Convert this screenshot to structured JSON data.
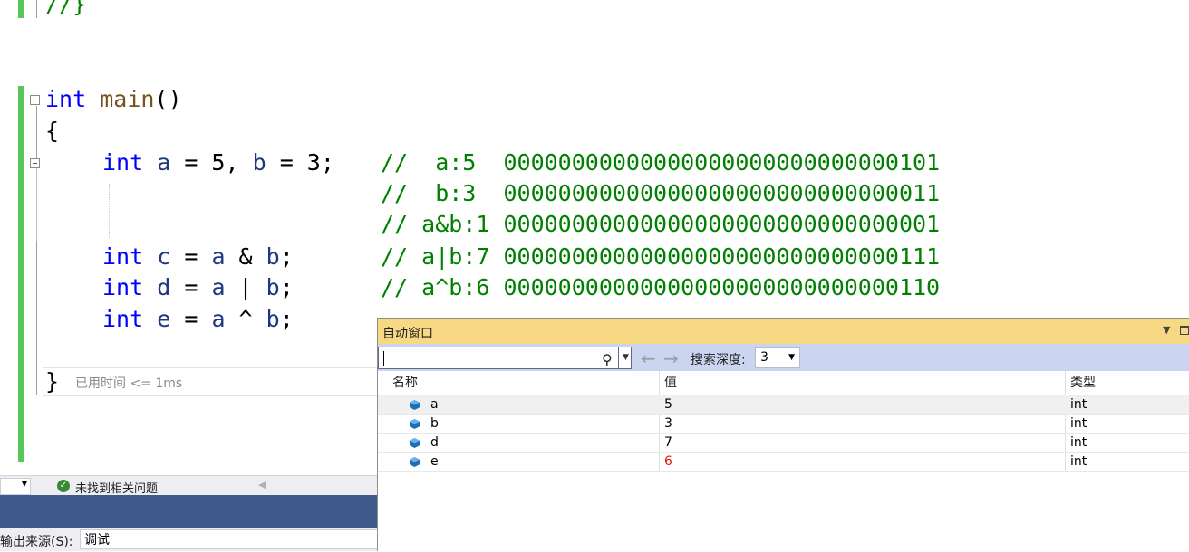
{
  "editor": {
    "line_prev": "//}",
    "line_main": {
      "kw": "int",
      "fn": "main",
      "rest": "()"
    },
    "line_open_brace": "{",
    "line_decl": {
      "kw": "int",
      "a": "a",
      "eq1": " = 5, ",
      "b": "b",
      "eq2": " = 3;"
    },
    "comments": [
      "//  a:5  00000000000000000000000000000101",
      "//  b:3  00000000000000000000000000000011",
      "// a&b:1 00000000000000000000000000000001",
      "// a|b:7 00000000000000000000000000000111",
      "// a^b:6 00000000000000000000000000000110"
    ],
    "line_c": {
      "kw": "int",
      "v": "c",
      "op1": " = ",
      "a": "a",
      "op": " & ",
      "b": "b",
      "end": ";"
    },
    "line_d": {
      "kw": "int",
      "v": "d",
      "op1": " = ",
      "a": "a",
      "op": " | ",
      "b": "b",
      "end": ";"
    },
    "line_e": {
      "kw": "int",
      "v": "e",
      "op1": " = ",
      "a": "a",
      "op": " ^ ",
      "b": "b",
      "end": ";"
    },
    "line_close_brace": "}",
    "elapsed": "已用时间 <= 1ms"
  },
  "status": {
    "issues": "未找到相关问题"
  },
  "output": {
    "source_label": "输出来源(S):",
    "source_value": "调试"
  },
  "autos": {
    "title": "自动窗口",
    "search_placeholder": "",
    "depth_label": "搜索深度:",
    "depth_value": "3",
    "columns": {
      "name": "名称",
      "value": "值",
      "type": "类型"
    },
    "rows": [
      {
        "name": "a",
        "value": "5",
        "type": "int",
        "changed": false
      },
      {
        "name": "b",
        "value": "3",
        "type": "int",
        "changed": false
      },
      {
        "name": "d",
        "value": "7",
        "type": "int",
        "changed": false
      },
      {
        "name": "e",
        "value": "6",
        "type": "int",
        "changed": true
      }
    ],
    "changed_color": "#e51400"
  },
  "icons": [
    "search-icon",
    "chevron-down-icon",
    "back-arrow-icon",
    "forward-arrow-icon",
    "variable-icon",
    "check-circle-icon",
    "maximize-icon"
  ]
}
